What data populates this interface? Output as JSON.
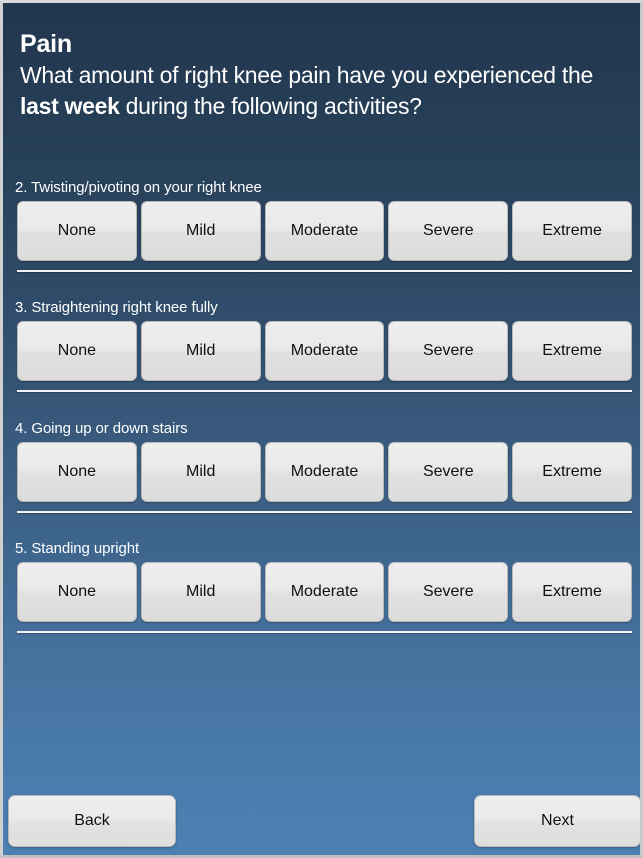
{
  "header": {
    "title": "Pain",
    "question_prefix": "What amount of right knee pain have you experienced the ",
    "question_emphasis": "last week",
    "question_suffix": " during the following activities?"
  },
  "scale_options": [
    "None",
    "Mild",
    "Moderate",
    "Severe",
    "Extreme"
  ],
  "questions": [
    {
      "label": "2. Twisting/pivoting on your right knee"
    },
    {
      "label": "3. Straightening right knee fully"
    },
    {
      "label": "4. Going up or down stairs"
    },
    {
      "label": "5. Standing upright"
    }
  ],
  "footer": {
    "back_label": "Back",
    "next_label": "Next"
  },
  "colors": {
    "background_top": "#22364e",
    "background_bottom": "#4d80b2",
    "button_face": "#e6e6e6",
    "text_light": "#ffffff",
    "text_dark": "#101010"
  }
}
